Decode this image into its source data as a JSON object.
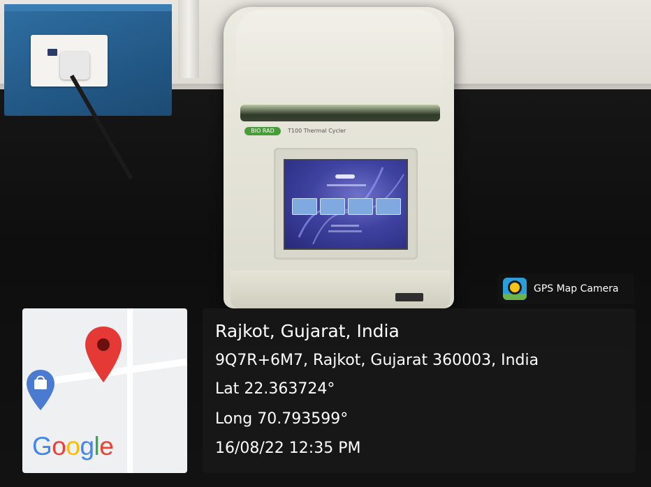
{
  "badge": {
    "label": "GPS Map Camera",
    "icon": "gps-map-camera-app-icon"
  },
  "map": {
    "logo_letters": [
      "G",
      "o",
      "o",
      "g",
      "l",
      "e"
    ],
    "logo_colors": [
      "#4285f4",
      "#ea4335",
      "#fbbc05",
      "#4285f4",
      "#34a853",
      "#ea4335"
    ],
    "pin_color": "#e53935",
    "shop_pin_color": "#4a7bd0"
  },
  "location": {
    "place": "Rajkot, Gujarat, India",
    "address": "9Q7R+6M7, Rajkot, Gujarat 360003, India",
    "latitude": "Lat 22.363724°",
    "longitude": "Long 70.793599°",
    "datetime": "16/08/22 12:35 PM"
  },
  "device": {
    "brand": "BIO RAD",
    "model": "T100 Thermal Cycler"
  }
}
